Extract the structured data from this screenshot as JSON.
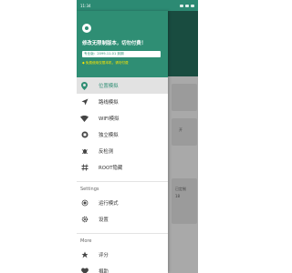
{
  "status_bar": {
    "time": "11:34"
  },
  "drawer": {
    "promo_text": "修改无限制版本，切勿付费！",
    "badge_text": "专业版：2099-11-01 到期",
    "notice_text": "◆ 免费使用仅限本机，请勿付费",
    "primary_items": [
      {
        "label": "位置模拟",
        "icon": "location-pin-icon",
        "active": true
      },
      {
        "label": "路线模拟",
        "icon": "navigation-arrow-icon",
        "active": false
      },
      {
        "label": "WIFI模拟",
        "icon": "wifi-icon",
        "active": false
      },
      {
        "label": "独立模拟",
        "icon": "stop-circle-icon",
        "active": false
      },
      {
        "label": "反检测",
        "icon": "bug-icon",
        "active": false
      },
      {
        "label": "ROOT隐藏",
        "icon": "hash-icon",
        "active": false
      }
    ],
    "settings_section": {
      "title": "Settings",
      "items": [
        {
          "label": "运行模式",
          "icon": "run-mode-icon"
        },
        {
          "label": "设置",
          "icon": "gear-icon"
        }
      ]
    },
    "more_section": {
      "title": "More",
      "items": [
        {
          "label": "评分",
          "icon": "star-icon"
        },
        {
          "label": "捐助",
          "icon": "heart-icon"
        }
      ]
    }
  },
  "background": {
    "partial_text_1": "开",
    "partial_text_2": "已定制",
    "partial_text_3": "18"
  },
  "colors": {
    "primary": "#2f8e74",
    "accent_yellow": "#ffe600",
    "active_bg": "#e2e2e2"
  }
}
